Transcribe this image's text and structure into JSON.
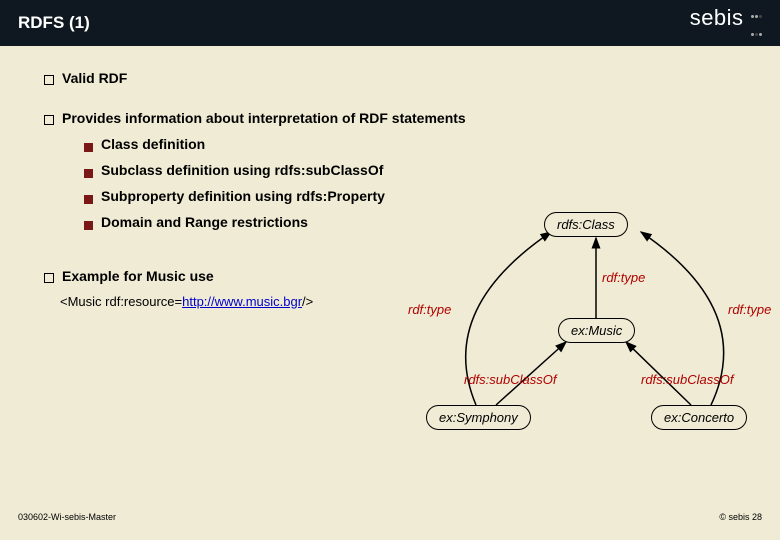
{
  "header": {
    "title": "RDFS (1)",
    "logo_text": "sebis"
  },
  "bullets": {
    "l1_0": "Valid RDF",
    "l1_1": "Provides information about interpretation of RDF statements",
    "l2_0": "Class definition",
    "l2_1": "Subclass definition using rdfs:subClassOf",
    "l2_2": "Subproperty definition using rdfs:Property",
    "l2_3": "Domain and Range restrictions",
    "l1_2": "Example for Music use"
  },
  "example": {
    "prefix": "<Music rdf:resource=",
    "link": "http://www.music.bgr",
    "suffix": "/>"
  },
  "diagram": {
    "nodes": {
      "class": "rdfs:Class",
      "music": "ex:Music",
      "symphony": "ex:Symphony",
      "concerto": "ex:Concerto"
    },
    "edges": {
      "type1": "rdf:type",
      "type2": "rdf:type",
      "type3": "rdf:type",
      "sub1": "rdfs:subClassOf",
      "sub2": "rdfs:subClassOf"
    }
  },
  "footer": {
    "left": "030602-Wi-sebis-Master",
    "right": "© sebis 28"
  }
}
